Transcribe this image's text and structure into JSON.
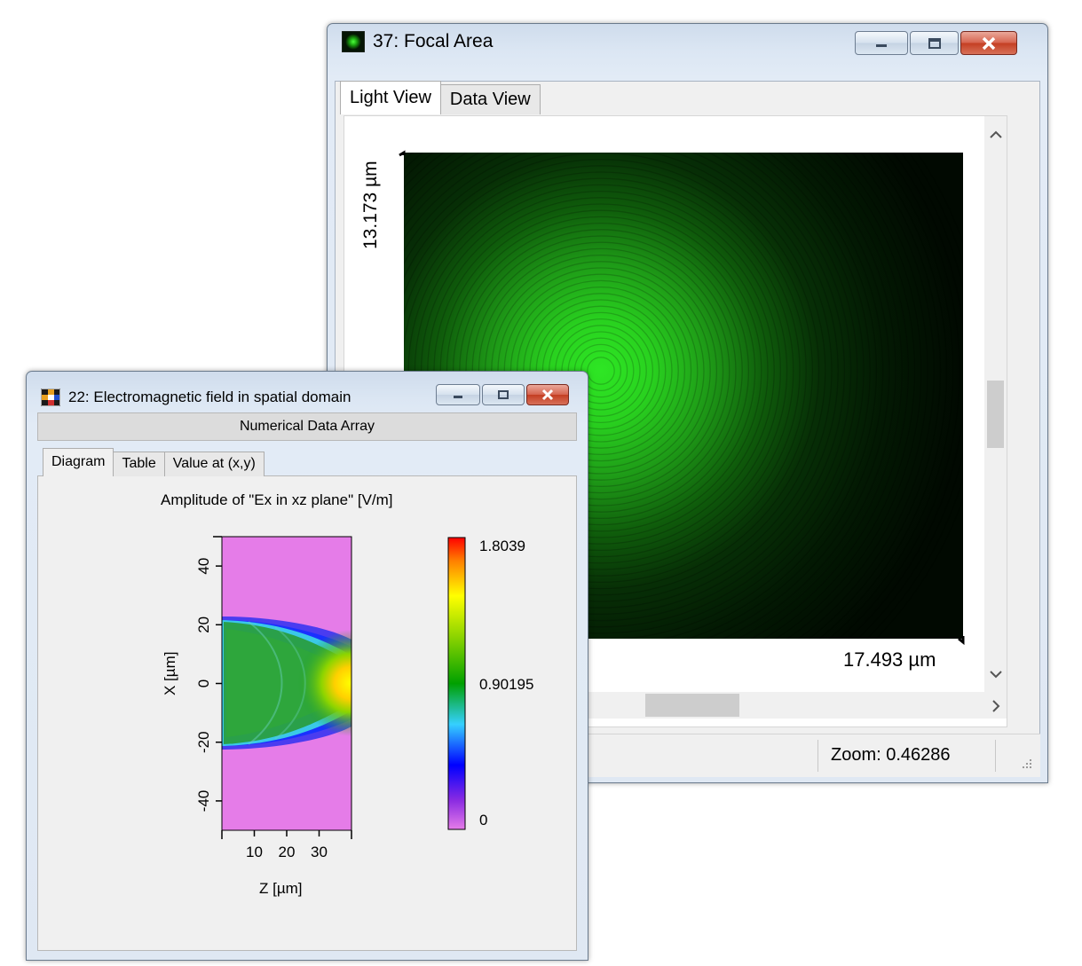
{
  "focal_window": {
    "title": "37: Focal Area",
    "tabs": [
      "Light View",
      "Data View"
    ],
    "active_tab": "Light View",
    "y_extent_label": "13.173 µm",
    "x_extent_label": "17.493 µm",
    "zoom_label": "Zoom: 0.46286",
    "colors": {
      "spot": "#29e31f",
      "background": "#000a00"
    }
  },
  "em_window": {
    "title": "22: Electromagnetic field in spatial domain",
    "subtitle": "Numerical Data Array",
    "tabs": [
      "Diagram",
      "Table",
      "Value at (x,y)"
    ],
    "active_tab": "Diagram",
    "diagram": {
      "title": "Amplitude of \"Ex in xz plane\"   [V/m]",
      "xlabel": "Z [µm]",
      "ylabel": "X [µm]",
      "x_ticks": [
        "10",
        "20",
        "30"
      ],
      "y_ticks": [
        "40",
        "20",
        "0",
        "-20",
        "-40"
      ],
      "colorbar_labels": [
        "1.8039",
        "0.90195",
        "0"
      ]
    }
  },
  "chart_data": {
    "type": "heatmap",
    "title": "Amplitude of \"Ex in xz plane\"   [V/m]",
    "xlabel": "Z [µm]",
    "ylabel": "X [µm]",
    "x_ticks": [
      10,
      20,
      30
    ],
    "y_ticks": [
      40,
      20,
      0,
      -20,
      -40
    ],
    "colorbar_range": [
      0,
      1.8039
    ],
    "colorbar_mid": 0.90195,
    "colormap": [
      "#e57ce8",
      "#8a2be2",
      "#0000ff",
      "#00ffff",
      "#00a000",
      "#ffff00",
      "#ff0000"
    ]
  }
}
